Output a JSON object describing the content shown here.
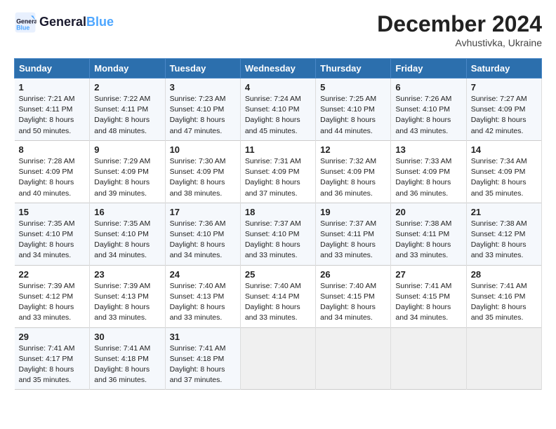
{
  "header": {
    "logo_line1": "General",
    "logo_line2": "Blue",
    "title": "December 2024",
    "subtitle": "Avhustivka, Ukraine"
  },
  "weekdays": [
    "Sunday",
    "Monday",
    "Tuesday",
    "Wednesday",
    "Thursday",
    "Friday",
    "Saturday"
  ],
  "weeks": [
    [
      {
        "day": "1",
        "lines": [
          "Sunrise: 7:21 AM",
          "Sunset: 4:11 PM",
          "Daylight: 8 hours",
          "and 50 minutes."
        ]
      },
      {
        "day": "2",
        "lines": [
          "Sunrise: 7:22 AM",
          "Sunset: 4:11 PM",
          "Daylight: 8 hours",
          "and 48 minutes."
        ]
      },
      {
        "day": "3",
        "lines": [
          "Sunrise: 7:23 AM",
          "Sunset: 4:10 PM",
          "Daylight: 8 hours",
          "and 47 minutes."
        ]
      },
      {
        "day": "4",
        "lines": [
          "Sunrise: 7:24 AM",
          "Sunset: 4:10 PM",
          "Daylight: 8 hours",
          "and 45 minutes."
        ]
      },
      {
        "day": "5",
        "lines": [
          "Sunrise: 7:25 AM",
          "Sunset: 4:10 PM",
          "Daylight: 8 hours",
          "and 44 minutes."
        ]
      },
      {
        "day": "6",
        "lines": [
          "Sunrise: 7:26 AM",
          "Sunset: 4:10 PM",
          "Daylight: 8 hours",
          "and 43 minutes."
        ]
      },
      {
        "day": "7",
        "lines": [
          "Sunrise: 7:27 AM",
          "Sunset: 4:09 PM",
          "Daylight: 8 hours",
          "and 42 minutes."
        ]
      }
    ],
    [
      {
        "day": "8",
        "lines": [
          "Sunrise: 7:28 AM",
          "Sunset: 4:09 PM",
          "Daylight: 8 hours",
          "and 40 minutes."
        ]
      },
      {
        "day": "9",
        "lines": [
          "Sunrise: 7:29 AM",
          "Sunset: 4:09 PM",
          "Daylight: 8 hours",
          "and 39 minutes."
        ]
      },
      {
        "day": "10",
        "lines": [
          "Sunrise: 7:30 AM",
          "Sunset: 4:09 PM",
          "Daylight: 8 hours",
          "and 38 minutes."
        ]
      },
      {
        "day": "11",
        "lines": [
          "Sunrise: 7:31 AM",
          "Sunset: 4:09 PM",
          "Daylight: 8 hours",
          "and 37 minutes."
        ]
      },
      {
        "day": "12",
        "lines": [
          "Sunrise: 7:32 AM",
          "Sunset: 4:09 PM",
          "Daylight: 8 hours",
          "and 36 minutes."
        ]
      },
      {
        "day": "13",
        "lines": [
          "Sunrise: 7:33 AM",
          "Sunset: 4:09 PM",
          "Daylight: 8 hours",
          "and 36 minutes."
        ]
      },
      {
        "day": "14",
        "lines": [
          "Sunrise: 7:34 AM",
          "Sunset: 4:09 PM",
          "Daylight: 8 hours",
          "and 35 minutes."
        ]
      }
    ],
    [
      {
        "day": "15",
        "lines": [
          "Sunrise: 7:35 AM",
          "Sunset: 4:10 PM",
          "Daylight: 8 hours",
          "and 34 minutes."
        ]
      },
      {
        "day": "16",
        "lines": [
          "Sunrise: 7:35 AM",
          "Sunset: 4:10 PM",
          "Daylight: 8 hours",
          "and 34 minutes."
        ]
      },
      {
        "day": "17",
        "lines": [
          "Sunrise: 7:36 AM",
          "Sunset: 4:10 PM",
          "Daylight: 8 hours",
          "and 34 minutes."
        ]
      },
      {
        "day": "18",
        "lines": [
          "Sunrise: 7:37 AM",
          "Sunset: 4:10 PM",
          "Daylight: 8 hours",
          "and 33 minutes."
        ]
      },
      {
        "day": "19",
        "lines": [
          "Sunrise: 7:37 AM",
          "Sunset: 4:11 PM",
          "Daylight: 8 hours",
          "and 33 minutes."
        ]
      },
      {
        "day": "20",
        "lines": [
          "Sunrise: 7:38 AM",
          "Sunset: 4:11 PM",
          "Daylight: 8 hours",
          "and 33 minutes."
        ]
      },
      {
        "day": "21",
        "lines": [
          "Sunrise: 7:38 AM",
          "Sunset: 4:12 PM",
          "Daylight: 8 hours",
          "and 33 minutes."
        ]
      }
    ],
    [
      {
        "day": "22",
        "lines": [
          "Sunrise: 7:39 AM",
          "Sunset: 4:12 PM",
          "Daylight: 8 hours",
          "and 33 minutes."
        ]
      },
      {
        "day": "23",
        "lines": [
          "Sunrise: 7:39 AM",
          "Sunset: 4:13 PM",
          "Daylight: 8 hours",
          "and 33 minutes."
        ]
      },
      {
        "day": "24",
        "lines": [
          "Sunrise: 7:40 AM",
          "Sunset: 4:13 PM",
          "Daylight: 8 hours",
          "and 33 minutes."
        ]
      },
      {
        "day": "25",
        "lines": [
          "Sunrise: 7:40 AM",
          "Sunset: 4:14 PM",
          "Daylight: 8 hours",
          "and 33 minutes."
        ]
      },
      {
        "day": "26",
        "lines": [
          "Sunrise: 7:40 AM",
          "Sunset: 4:15 PM",
          "Daylight: 8 hours",
          "and 34 minutes."
        ]
      },
      {
        "day": "27",
        "lines": [
          "Sunrise: 7:41 AM",
          "Sunset: 4:15 PM",
          "Daylight: 8 hours",
          "and 34 minutes."
        ]
      },
      {
        "day": "28",
        "lines": [
          "Sunrise: 7:41 AM",
          "Sunset: 4:16 PM",
          "Daylight: 8 hours",
          "and 35 minutes."
        ]
      }
    ],
    [
      {
        "day": "29",
        "lines": [
          "Sunrise: 7:41 AM",
          "Sunset: 4:17 PM",
          "Daylight: 8 hours",
          "and 35 minutes."
        ]
      },
      {
        "day": "30",
        "lines": [
          "Sunrise: 7:41 AM",
          "Sunset: 4:18 PM",
          "Daylight: 8 hours",
          "and 36 minutes."
        ]
      },
      {
        "day": "31",
        "lines": [
          "Sunrise: 7:41 AM",
          "Sunset: 4:18 PM",
          "Daylight: 8 hours",
          "and 37 minutes."
        ]
      },
      null,
      null,
      null,
      null
    ]
  ]
}
